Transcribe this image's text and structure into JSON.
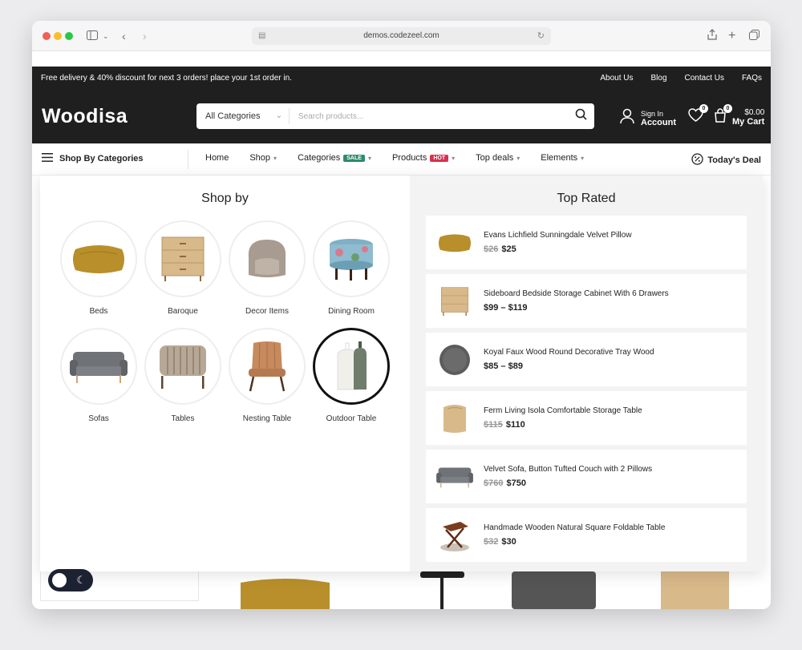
{
  "browser": {
    "url": "demos.codezeel.com"
  },
  "topbar": {
    "promo": "Free delivery & 40% discount for next 3 orders! place your 1st order in.",
    "links": [
      "About Us",
      "Blog",
      "Contact Us",
      "FAQs"
    ]
  },
  "header": {
    "logo": "Woodisa",
    "search_category": "All Categories",
    "search_placeholder": "Search products...",
    "sign_in": "Sign In",
    "account": "Account",
    "wishlist_count": "0",
    "cart_count": "0",
    "cart_total": "$0.00",
    "cart_label": "My Cart"
  },
  "nav": {
    "shop_by_categories": "Shop By Categories",
    "items": [
      {
        "label": "Home",
        "badge": "",
        "dropdown": false
      },
      {
        "label": "Shop",
        "badge": "",
        "dropdown": true
      },
      {
        "label": "Categories",
        "badge": "SALE",
        "badge_color": "#2f8a6e",
        "dropdown": true
      },
      {
        "label": "Products",
        "badge": "HOT",
        "badge_color": "#d8304f",
        "dropdown": true
      },
      {
        "label": "Top deals",
        "badge": "",
        "dropdown": true
      },
      {
        "label": "Elements",
        "badge": "",
        "dropdown": true
      }
    ],
    "todays_deal": "Today's Deal"
  },
  "mega": {
    "shop_by_title": "Shop by",
    "categories": [
      {
        "label": "Beds",
        "icon": "pillow"
      },
      {
        "label": "Baroque",
        "icon": "drawers"
      },
      {
        "label": "Decor Items",
        "icon": "armchair-round"
      },
      {
        "label": "Dining Room",
        "icon": "ottoman"
      },
      {
        "label": "Sofas",
        "icon": "sofa"
      },
      {
        "label": "Tables",
        "icon": "striped-chair"
      },
      {
        "label": "Nesting Table",
        "icon": "leather-chair"
      },
      {
        "label": "Outdoor Table",
        "icon": "bottles"
      }
    ],
    "top_rated_title": "Top Rated",
    "products": [
      {
        "name": "Evans Lichfield Sunningdale Velvet Pillow",
        "old": "$26",
        "price": "$25",
        "icon": "pillow"
      },
      {
        "name": "Sideboard Bedside Storage Cabinet With 6 Drawers",
        "old": "",
        "price": "$99 – $119",
        "icon": "drawers"
      },
      {
        "name": "Koyal Faux Wood Round Decorative Tray Wood",
        "old": "",
        "price": "$85 – $89",
        "icon": "tray"
      },
      {
        "name": "Ferm Living Isola Comfortable Storage Table",
        "old": "$115",
        "price": "$110",
        "icon": "stool"
      },
      {
        "name": "Velvet Sofa, Button Tufted Couch with 2 Pillows",
        "old": "$760",
        "price": "$750",
        "icon": "sofa"
      },
      {
        "name": "Handmade Wooden Natural Square Foldable Table",
        "old": "$32",
        "price": "$30",
        "icon": "side-table"
      }
    ]
  },
  "colors": {
    "dark": "#1f1f1f",
    "sale": "#2f8a6e",
    "hot": "#d8304f",
    "mustard": "#b88f2a",
    "wood": "#d8b98a"
  }
}
